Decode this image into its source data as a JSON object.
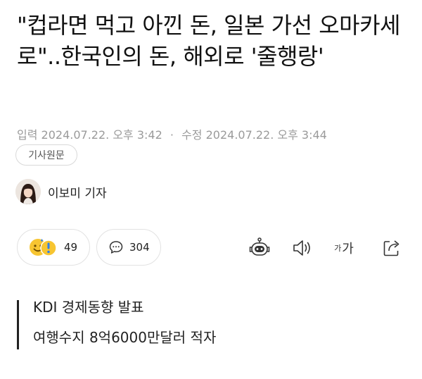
{
  "article": {
    "headline": "\"컵라면 먹고 아낀 돈, 일본 가선 오마카세로\"..한국인의 돈, 해외로 '줄행랑'",
    "published_label": "입력",
    "published": "2024.07.22. 오후 3:42",
    "separator": "·",
    "modified_label": "수정",
    "modified": "2024.07.22. 오후 3:44",
    "original_button": "기사원문",
    "author": "이보미 기자"
  },
  "actions": {
    "reactions_count": "49",
    "comments_count": "304",
    "font_small": "가",
    "font_large": "가"
  },
  "summary": {
    "lines": [
      "KDI 경제동향 발표",
      "여행수지 8억6000만달러 적자"
    ]
  },
  "colors": {
    "text": "#111111",
    "muted": "#9a9a9a",
    "border": "#e2e2e2",
    "emoji_yellow": "#f7c531",
    "emoji_blue": "#2f80ed"
  },
  "icons": [
    "smile-emoji-icon",
    "exclamation-emoji-icon",
    "comment-icon",
    "robot-icon",
    "speaker-icon",
    "share-icon"
  ]
}
